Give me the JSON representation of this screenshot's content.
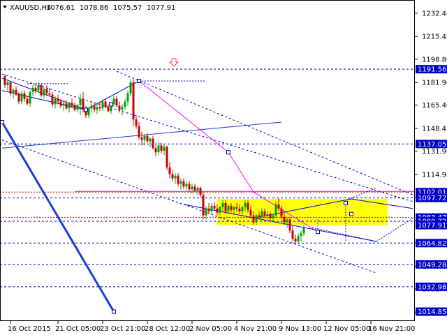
{
  "header": {
    "symbol": "XAUUSD,H4",
    "open": "1076.61",
    "high": "1078.86",
    "low": "1075.57",
    "close": "1077.91"
  },
  "chart_data": {
    "type": "candlestick",
    "title": "XAUUSD,H4",
    "ylim": [
      1008,
      1242
    ],
    "yticks": [
      {
        "label": "1232.40",
        "value": 1232.4
      },
      {
        "label": "1215.45",
        "value": 1215.45
      },
      {
        "label": "1198.80",
        "value": 1198.8
      },
      {
        "label": "1181.90",
        "value": 1181.9
      },
      {
        "label": "1165.40",
        "value": 1165.4
      },
      {
        "label": "1148.45",
        "value": 1148.45
      },
      {
        "label": "1131.90",
        "value": 1131.9
      },
      {
        "label": "1114.95",
        "value": 1114.95
      },
      {
        "label": "1098.00",
        "value": 1098.0
      },
      {
        "label": "1081.45",
        "value": 1081.45
      },
      {
        "label": "1064.95",
        "value": 1064.95
      },
      {
        "label": "1048.00",
        "value": 1048.0
      },
      {
        "label": "1031.45",
        "value": 1031.45
      },
      {
        "label": "1014.50",
        "value": 1014.5
      }
    ],
    "level_tags": [
      {
        "label": "1191.56",
        "value": 1191.56
      },
      {
        "label": "1137.05",
        "value": 1137.05
      },
      {
        "label": "1102.01",
        "value": 1102.01
      },
      {
        "label": "1097.72",
        "value": 1097.72
      },
      {
        "label": "1083.47",
        "value": 1083.47
      },
      {
        "label": "1080.72",
        "value": 1080.72
      },
      {
        "label": "1077.91",
        "value": 1077.91
      },
      {
        "label": "1064.82",
        "value": 1064.82
      },
      {
        "label": "1049.28",
        "value": 1049.28
      },
      {
        "label": "1032.98",
        "value": 1032.98
      },
      {
        "label": "1014.85",
        "value": 1014.85
      }
    ],
    "x_labels": [
      {
        "label": "16 Oct 2015",
        "bar": 2
      },
      {
        "label": "21 Oct 05:00",
        "bar": 19
      },
      {
        "label": "23 Oct 21:00",
        "bar": 35
      },
      {
        "label": "28 Oct 12:00",
        "bar": 51
      },
      {
        "label": "2 Nov 05:00",
        "bar": 67
      },
      {
        "label": "4 Nov 21:00",
        "bar": 83
      },
      {
        "label": "9 Nov 13:00",
        "bar": 99
      },
      {
        "label": "12 Nov 05:00",
        "bar": 115
      },
      {
        "label": "16 Nov 21:00",
        "bar": 131
      }
    ],
    "zone": {
      "bar_from": 76,
      "bar_to": 137,
      "high": 1097.0,
      "low": 1078.0,
      "color": "#ffff00"
    },
    "colors": {
      "bull": "#00a000",
      "bear": "#c80000",
      "level_line": "#0000c8",
      "magenta": "#ff00ff",
      "tag_bg": "#0000c8",
      "arrow": "#ff4040",
      "trend": "#1a3cd8"
    },
    "ohlc": [
      [
        1186.5,
        1188.0,
        1178.0,
        1180.0
      ],
      [
        1180.0,
        1184.0,
        1176.0,
        1182.0
      ],
      [
        1182.0,
        1183.0,
        1172.0,
        1174.0
      ],
      [
        1174.0,
        1178.0,
        1170.0,
        1176.5
      ],
      [
        1176.5,
        1179.0,
        1172.0,
        1173.0
      ],
      [
        1173.0,
        1175.0,
        1166.0,
        1168.0
      ],
      [
        1168.0,
        1176.0,
        1166.0,
        1174.0
      ],
      [
        1174.0,
        1176.0,
        1168.0,
        1170.0
      ],
      [
        1170.0,
        1172.0,
        1165.0,
        1166.5
      ],
      [
        1166.5,
        1176.0,
        1164.0,
        1175.0
      ],
      [
        1175.0,
        1180.0,
        1172.0,
        1178.0
      ],
      [
        1178.0,
        1180.0,
        1174.0,
        1176.0
      ],
      [
        1176.0,
        1182.0,
        1174.0,
        1180.0
      ],
      [
        1180.0,
        1181.0,
        1171.0,
        1172.5
      ],
      [
        1172.5,
        1178.0,
        1170.0,
        1177.0
      ],
      [
        1177.0,
        1180.0,
        1172.0,
        1174.0
      ],
      [
        1174.0,
        1178.0,
        1172.0,
        1173.0
      ],
      [
        1173.0,
        1175.0,
        1164.0,
        1166.0
      ],
      [
        1166.0,
        1172.0,
        1163.0,
        1170.0
      ],
      [
        1170.0,
        1173.0,
        1166.0,
        1168.0
      ],
      [
        1168.0,
        1170.0,
        1163.0,
        1165.0
      ],
      [
        1165.0,
        1168.0,
        1161.0,
        1166.5
      ],
      [
        1166.5,
        1169.0,
        1162.0,
        1163.0
      ],
      [
        1163.0,
        1168.0,
        1160.0,
        1167.0
      ],
      [
        1167.0,
        1170.0,
        1163.0,
        1165.0
      ],
      [
        1165.0,
        1167.0,
        1161.0,
        1162.0
      ],
      [
        1162.0,
        1166.0,
        1160.0,
        1165.5
      ],
      [
        1165.5,
        1174.0,
        1158.0,
        1170.0
      ],
      [
        1170.0,
        1175.0,
        1160.0,
        1162.0
      ],
      [
        1162.0,
        1165.0,
        1156.0,
        1158.0
      ],
      [
        1158.0,
        1164.0,
        1156.0,
        1163.0
      ],
      [
        1163.0,
        1168.0,
        1160.0,
        1165.0
      ],
      [
        1165.0,
        1167.0,
        1160.0,
        1162.0
      ],
      [
        1162.0,
        1166.0,
        1159.0,
        1164.0
      ],
      [
        1164.0,
        1168.0,
        1161.0,
        1163.0
      ],
      [
        1163.0,
        1170.0,
        1161.0,
        1168.0
      ],
      [
        1168.0,
        1170.0,
        1163.0,
        1164.0
      ],
      [
        1164.0,
        1166.0,
        1160.0,
        1161.0
      ],
      [
        1161.0,
        1167.0,
        1159.0,
        1166.0
      ],
      [
        1166.0,
        1172.0,
        1164.0,
        1170.0
      ],
      [
        1170.0,
        1172.0,
        1164.0,
        1165.0
      ],
      [
        1165.0,
        1168.0,
        1160.0,
        1162.0
      ],
      [
        1162.0,
        1166.0,
        1158.0,
        1164.0
      ],
      [
        1164.0,
        1170.0,
        1162.0,
        1168.0
      ],
      [
        1168.0,
        1176.0,
        1165.0,
        1174.0
      ],
      [
        1174.0,
        1184.0,
        1172.0,
        1182.0
      ],
      [
        1182.0,
        1184.0,
        1150.0,
        1155.0
      ],
      [
        1155.0,
        1158.0,
        1148.0,
        1150.0
      ],
      [
        1150.0,
        1153.0,
        1140.0,
        1142.0
      ],
      [
        1142.0,
        1146.0,
        1136.0,
        1140.0
      ],
      [
        1140.0,
        1144.0,
        1136.0,
        1143.0
      ],
      [
        1143.0,
        1145.0,
        1138.0,
        1139.0
      ],
      [
        1139.0,
        1142.0,
        1135.0,
        1141.0
      ],
      [
        1141.0,
        1143.0,
        1133.0,
        1134.0
      ],
      [
        1134.0,
        1136.0,
        1128.0,
        1131.0
      ],
      [
        1131.0,
        1138.0,
        1129.0,
        1136.0
      ],
      [
        1136.0,
        1138.0,
        1130.0,
        1132.0
      ],
      [
        1132.0,
        1137.0,
        1129.0,
        1135.0
      ],
      [
        1135.0,
        1136.0,
        1118.0,
        1120.0
      ],
      [
        1120.0,
        1124.0,
        1112.0,
        1115.0
      ],
      [
        1115.0,
        1118.0,
        1110.0,
        1112.0
      ],
      [
        1112.0,
        1116.0,
        1108.0,
        1114.0
      ],
      [
        1114.0,
        1116.0,
        1106.0,
        1108.0
      ],
      [
        1108.0,
        1112.0,
        1104.0,
        1110.0
      ],
      [
        1110.0,
        1112.0,
        1104.0,
        1106.0
      ],
      [
        1106.0,
        1110.0,
        1103.0,
        1108.0
      ],
      [
        1108.0,
        1110.0,
        1102.0,
        1104.0
      ],
      [
        1104.0,
        1108.0,
        1101.0,
        1106.0
      ],
      [
        1106.0,
        1108.0,
        1102.0,
        1103.0
      ],
      [
        1103.0,
        1106.0,
        1100.0,
        1105.0
      ],
      [
        1105.0,
        1106.0,
        1098.0,
        1100.0
      ],
      [
        1100.0,
        1102.0,
        1082.0,
        1085.0
      ],
      [
        1085.0,
        1092.0,
        1082.0,
        1090.0
      ],
      [
        1090.0,
        1094.0,
        1086.0,
        1088.0
      ],
      [
        1088.0,
        1094.0,
        1086.0,
        1092.0
      ],
      [
        1092.0,
        1095.0,
        1088.0,
        1090.0
      ],
      [
        1090.0,
        1093.0,
        1085.0,
        1087.0
      ],
      [
        1087.0,
        1092.0,
        1085.0,
        1091.0
      ],
      [
        1091.0,
        1096.0,
        1088.0,
        1094.0
      ],
      [
        1094.0,
        1096.0,
        1086.0,
        1088.0
      ],
      [
        1088.0,
        1093.0,
        1086.0,
        1092.0
      ],
      [
        1092.0,
        1094.0,
        1087.0,
        1089.0
      ],
      [
        1089.0,
        1092.0,
        1085.0,
        1091.0
      ],
      [
        1091.0,
        1094.0,
        1088.0,
        1090.0
      ],
      [
        1090.0,
        1093.0,
        1086.0,
        1088.0
      ],
      [
        1088.0,
        1092.0,
        1085.0,
        1091.0
      ],
      [
        1091.0,
        1096.0,
        1088.0,
        1094.0
      ],
      [
        1094.0,
        1096.0,
        1087.0,
        1089.0
      ],
      [
        1089.0,
        1092.0,
        1083.0,
        1085.0
      ],
      [
        1085.0,
        1088.0,
        1078.0,
        1080.0
      ],
      [
        1080.0,
        1086.0,
        1078.0,
        1085.0
      ],
      [
        1085.0,
        1088.0,
        1082.0,
        1084.0
      ],
      [
        1084.0,
        1090.0,
        1082.0,
        1088.0
      ],
      [
        1088.0,
        1090.0,
        1083.0,
        1085.0
      ],
      [
        1085.0,
        1088.0,
        1082.0,
        1086.0
      ],
      [
        1086.0,
        1088.0,
        1081.0,
        1083.0
      ],
      [
        1083.0,
        1086.0,
        1080.0,
        1085.0
      ],
      [
        1085.0,
        1095.0,
        1083.0,
        1093.0
      ],
      [
        1093.0,
        1098.0,
        1088.0,
        1090.0
      ],
      [
        1090.0,
        1092.0,
        1082.0,
        1084.0
      ],
      [
        1084.0,
        1087.0,
        1078.0,
        1080.0
      ],
      [
        1080.0,
        1084.0,
        1076.0,
        1082.0
      ],
      [
        1082.0,
        1084.0,
        1072.0,
        1074.0
      ],
      [
        1074.0,
        1078.0,
        1066.0,
        1068.0
      ],
      [
        1068.0,
        1071.0,
        1064.0,
        1066.0
      ],
      [
        1066.0,
        1072.0,
        1064.0,
        1070.0
      ],
      [
        1070.0,
        1074.0,
        1066.0,
        1072.0
      ],
      [
        1072.0,
        1078.0,
        1070.0,
        1076.61
      ]
    ]
  }
}
